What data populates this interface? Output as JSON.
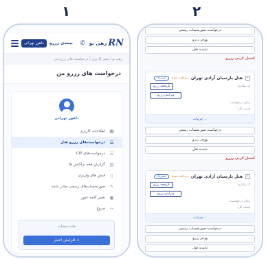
{
  "step_numbers": [
    "۱",
    "۲"
  ],
  "app": {
    "logo_mark": "RN",
    "logo_text": "رهی نو",
    "insurance_label": "بیمه‌ی رزرو",
    "user_chip": "داهور تهرانی"
  },
  "breadcrumb": "رهی نو / پیش کاربری / درخواست های رزرو من",
  "page_title": "درخواست های رزرو من",
  "profile": {
    "name": "داهور تهرانی"
  },
  "menu": [
    {
      "label": "اطلاعات کاربری",
      "icon": "user-icon"
    },
    {
      "label": "درخواست‌های رزرو هتل",
      "icon": "list-icon",
      "active": true
    },
    {
      "label": "درخواست‌های CIP",
      "icon": "list-icon"
    },
    {
      "label": "گزارش همه تراکنش ها",
      "icon": "report-icon"
    },
    {
      "label": "فیش های واریزی",
      "icon": "receipt-icon"
    },
    {
      "label": "صورتحساب‌های رسمی صادر شده",
      "icon": "invoice-icon"
    },
    {
      "label": "تغییر کلمه عبور",
      "icon": "lock-icon"
    },
    {
      "label": "خروج",
      "icon": "logout-icon"
    }
  ],
  "balance": {
    "label": "مانده حساب",
    "charge_button": "+ افزایش اعتبار"
  },
  "reservation_actions": {
    "invoice": "درخواست صورتحساب رسمی",
    "voucher": "ووچر رزرو",
    "hotel_confirm": "تاییدیه هتل",
    "cancel": "کنسل کردن رزرو"
  },
  "hotel_cards": [
    {
      "name": "هتل پارسیان آزادی تهران",
      "paid": "پرداخت شده",
      "status": "استرداد",
      "followup_label": "کد پیگیری:",
      "history_button": "تاریخچه رزرو",
      "edit_button": "ویرایش رزرو",
      "request_time_label": "زمان درخواست:",
      "total_price_label": "قیمت کل:",
      "details_link": "جزئیات"
    },
    {
      "name": "هتل پارسیان آزادی تهران",
      "paid": "پرداخت شده",
      "status": "استرداد",
      "followup_label": "کد پیگیری:",
      "history_button": "تاریخچه رزرو",
      "edit_button": "ویرایش رزرو",
      "request_time_label": "زمان درخواست:",
      "total_price_label": "قیمت کل:",
      "details_link": "جزئیات"
    }
  ],
  "colors": {
    "brand": "#1f3f8c",
    "accent": "#3a6fd8",
    "danger": "#d13a3a",
    "paid": "#e07a2a"
  }
}
